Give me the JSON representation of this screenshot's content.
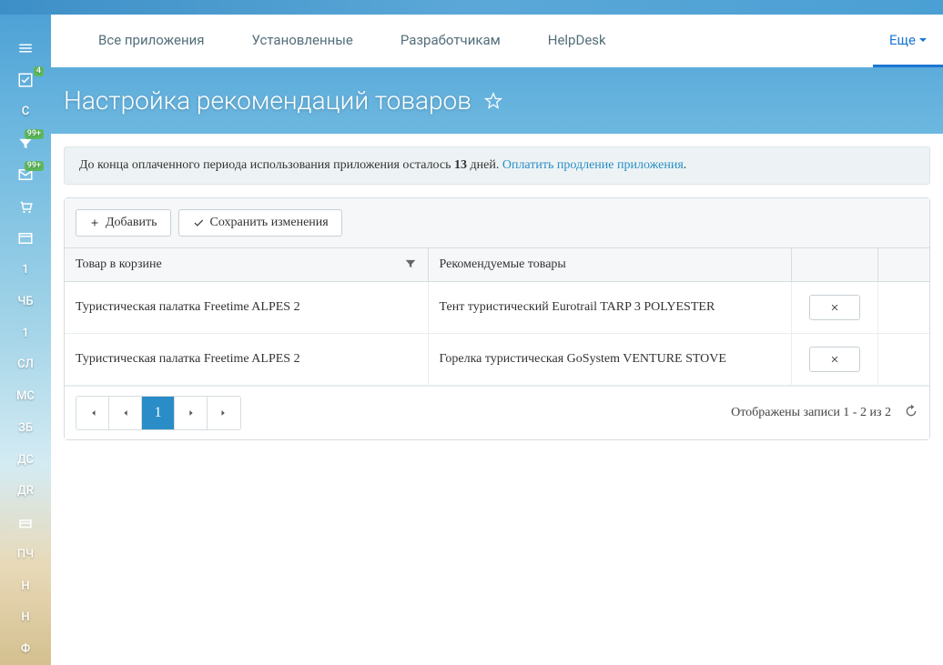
{
  "sidebar": {
    "items": [
      {
        "icon": "menu",
        "label": ""
      },
      {
        "icon": "check",
        "label": "",
        "badge": "4"
      },
      {
        "icon": "",
        "label": "С"
      },
      {
        "icon": "filter",
        "label": "",
        "badge": "99+"
      },
      {
        "icon": "mail",
        "label": "",
        "badge": "99+"
      },
      {
        "icon": "cart",
        "label": ""
      },
      {
        "icon": "window",
        "label": ""
      },
      {
        "icon": "",
        "label": "1"
      },
      {
        "icon": "",
        "label": "ЧБ"
      },
      {
        "icon": "",
        "label": "1"
      },
      {
        "icon": "",
        "label": "СЛ"
      },
      {
        "icon": "",
        "label": "МС"
      },
      {
        "icon": "",
        "label": "ЗБ"
      },
      {
        "icon": "",
        "label": "ДС"
      },
      {
        "icon": "",
        "label": "ДR"
      },
      {
        "icon": "drawer",
        "label": ""
      },
      {
        "icon": "",
        "label": "ПЧ"
      },
      {
        "icon": "",
        "label": "Н"
      },
      {
        "icon": "",
        "label": "Н"
      },
      {
        "icon": "",
        "label": "Ф"
      }
    ]
  },
  "tabs": [
    {
      "label": "Все приложения"
    },
    {
      "label": "Установленные"
    },
    {
      "label": "Разработчикам"
    },
    {
      "label": "HelpDesk"
    }
  ],
  "tabs_more": "Еще",
  "page_title": "Настройка рекомендаций товаров",
  "notice": {
    "prefix": "До конца оплаченного периода использования приложения осталось ",
    "days": "13",
    "middle": " дней. ",
    "link": "Оплатить продление приложения",
    "suffix": "."
  },
  "toolbar": {
    "add_label": "Добавить",
    "save_label": "Сохранить изменения"
  },
  "columns": {
    "cart": "Товар в корзине",
    "recommended": "Рекомендуемые товары"
  },
  "rows": [
    {
      "cart": "Туристическая палатка Freetime ALPES 2",
      "rec": "Тент туристический Eurotrail TARP 3 POLYESTER"
    },
    {
      "cart": "Туристическая палатка Freetime ALPES 2",
      "rec": "Горелка туристическая GoSystem VENTURE STOVE"
    }
  ],
  "pager": {
    "current": "1",
    "info": "Отображены записи 1 - 2 из 2"
  }
}
